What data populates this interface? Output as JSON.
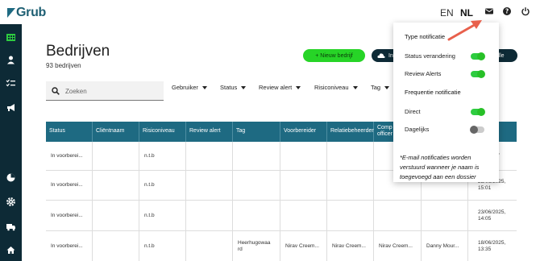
{
  "app": {
    "name": "Grub"
  },
  "header": {
    "lang_en": "EN",
    "lang_nl": "NL"
  },
  "icons": [
    "mail-icon",
    "help-icon",
    "power-icon",
    "building-icon",
    "user-icon",
    "checklist-icon",
    "megaphone-icon",
    "pie-chart-icon",
    "settings-icon",
    "truck-icon",
    "home-icon",
    "search-icon",
    "upload-icon"
  ],
  "colors": {
    "primary": "#1e6a82",
    "sidebar": "#0d2a36",
    "accent_green": "#27d427",
    "arrow": "#e8604c"
  },
  "page": {
    "title": "Bedrijven",
    "count": "93 bedrijven"
  },
  "actions": {
    "new_company": "+ Nieuw bedrijf",
    "import": "In",
    "right_partial": "ille"
  },
  "search": {
    "placeholder": "Zoeken"
  },
  "filters": [
    "Gebruiker",
    "Status",
    "Review alert",
    "Risiconiveau",
    "Tag"
  ],
  "table": {
    "columns": [
      "Status",
      "Cliëntnaam",
      "Risiconiveau",
      "Review alert",
      "Tag",
      "Voorbereider",
      "Relatiebeheerder",
      "Comp\nofficer",
      "",
      "ma"
    ],
    "rows": [
      {
        "status": "In voorberei...",
        "client": "",
        "risk": "n.t.b",
        "review": "",
        "tag": "",
        "prep": "",
        "rel": "",
        "comp": "",
        "owner": "",
        "date": "/06/2025,\n5"
      },
      {
        "status": "In voorberei...",
        "client": "",
        "risk": "n.t.b",
        "review": "",
        "tag": "",
        "prep": "",
        "rel": "",
        "comp": "",
        "owner": "",
        "date": "23/06/2025,\n15:01"
      },
      {
        "status": "In voorberei...",
        "client": "",
        "risk": "n.t.b",
        "review": "",
        "tag": "",
        "prep": "",
        "rel": "",
        "comp": "",
        "owner": "",
        "date": "23/06/2025,\n14:05"
      },
      {
        "status": "In voorberei...",
        "client": "",
        "risk": "n.t.b",
        "review": "",
        "tag": "Heerhugowaa\nrd",
        "prep": "Nirav Creem...",
        "rel": "Nirav Creem...",
        "comp": "Nirav Creem...",
        "owner": "Danny Mour...",
        "date": "18/06/2025,\n13:35"
      }
    ]
  },
  "notifications": {
    "type_heading": "Type notificatie",
    "status_change": {
      "label": "Status verandering",
      "on": true
    },
    "review_alerts": {
      "label": "Review Alerts",
      "on": true
    },
    "frequency_heading": "Frequentie notificatie",
    "direct": {
      "label": "Direct",
      "on": true
    },
    "daily": {
      "label": "Dagelijks",
      "on": false
    },
    "note": "*E-mail notificaties worden verstuurd wanneer je naam is toegevoegd aan een dossier"
  }
}
